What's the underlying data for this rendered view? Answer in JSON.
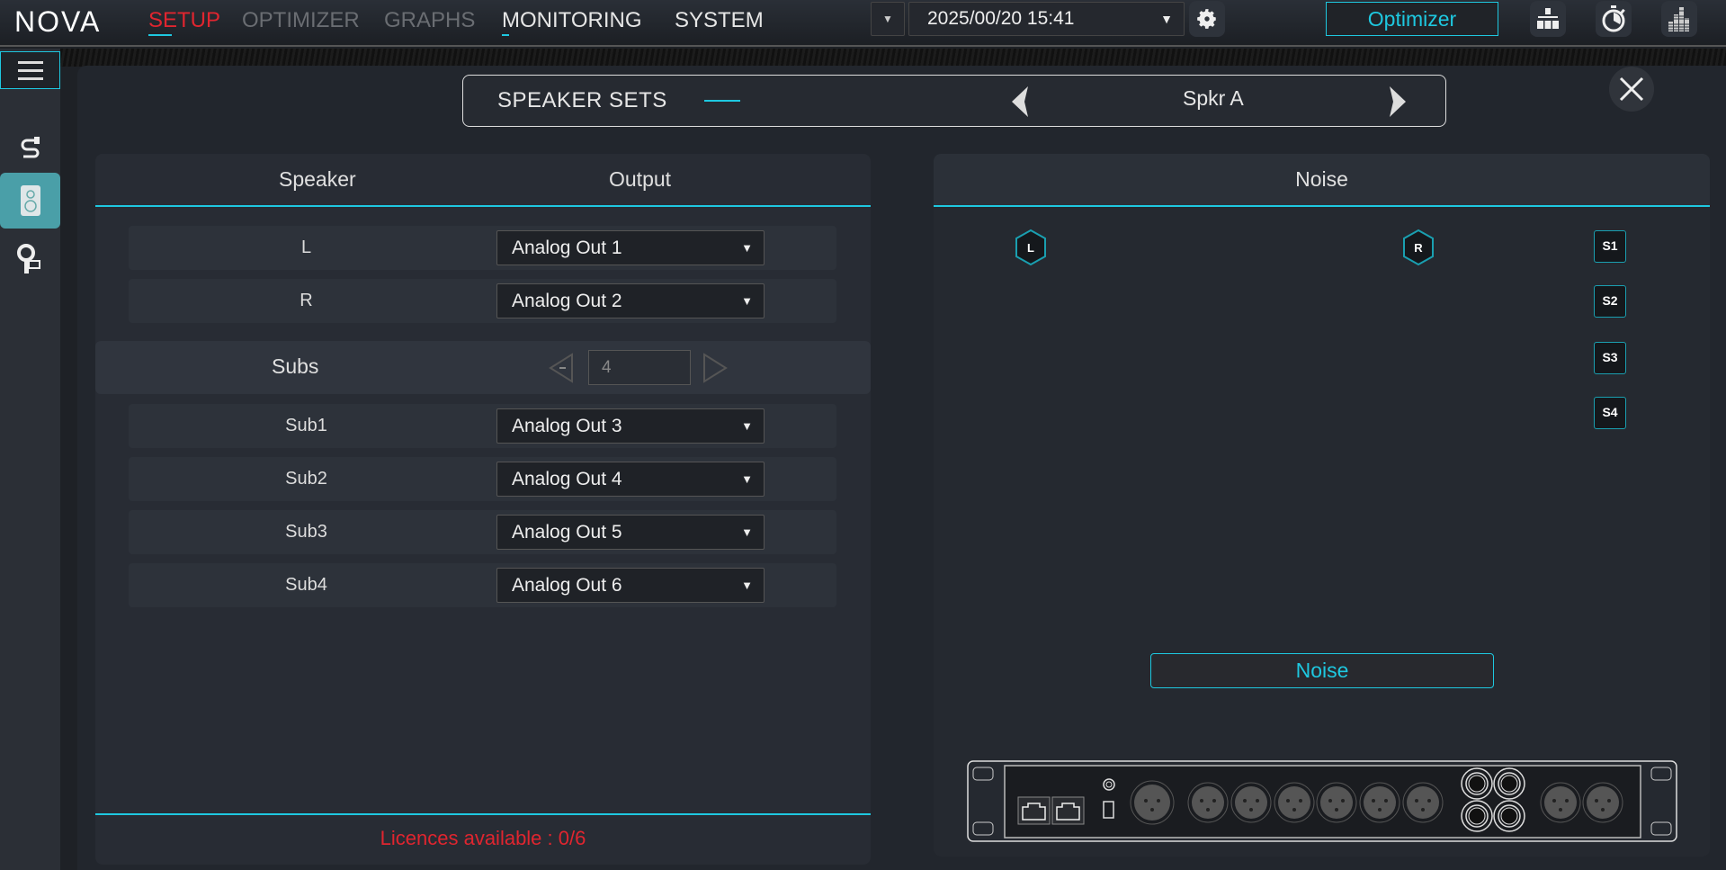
{
  "app": {
    "logo": "NOVA"
  },
  "nav": {
    "items": [
      {
        "label": "SETUP",
        "state": "active"
      },
      {
        "label": "OPTIMIZER",
        "state": "disabled"
      },
      {
        "label": "GRAPHS",
        "state": "disabled"
      },
      {
        "label": "MONITORING",
        "state": "normal"
      },
      {
        "label": "SYSTEM",
        "state": "normal"
      }
    ]
  },
  "toolbar": {
    "datetime": "2025/00/20 15:41",
    "optimizer_label": "Optimizer",
    "icons": [
      "gear-icon",
      "network-icon",
      "stopwatch-icon",
      "spectrum-icon"
    ]
  },
  "sidebar": {
    "icons": [
      "menu-icon",
      "cable-icon",
      "speaker-icon",
      "connector-icon"
    ]
  },
  "speaker_sets": {
    "title": "SPEAKER SETS",
    "current": "Spkr A"
  },
  "left_panel": {
    "col_speaker": "Speaker",
    "col_output": "Output",
    "mains": [
      {
        "speaker": "L",
        "output": "Analog Out 1"
      },
      {
        "speaker": "R",
        "output": "Analog Out 2"
      }
    ],
    "subs_label": "Subs",
    "subs_count": "4",
    "subs": [
      {
        "speaker": "Sub1",
        "output": "Analog Out 3"
      },
      {
        "speaker": "Sub2",
        "output": "Analog Out 4"
      },
      {
        "speaker": "Sub3",
        "output": "Analog Out 5"
      },
      {
        "speaker": "Sub4",
        "output": "Analog Out 6"
      }
    ],
    "licences": "Licences available : 0/6"
  },
  "right_panel": {
    "title": "Noise",
    "speakers": [
      "L",
      "R"
    ],
    "subs": [
      "S1",
      "S2",
      "S3",
      "S4"
    ],
    "noise_button": "Noise"
  },
  "colors": {
    "accent": "#1ec8e0",
    "active_nav": "#e0252f",
    "warning": "#e0252f"
  }
}
